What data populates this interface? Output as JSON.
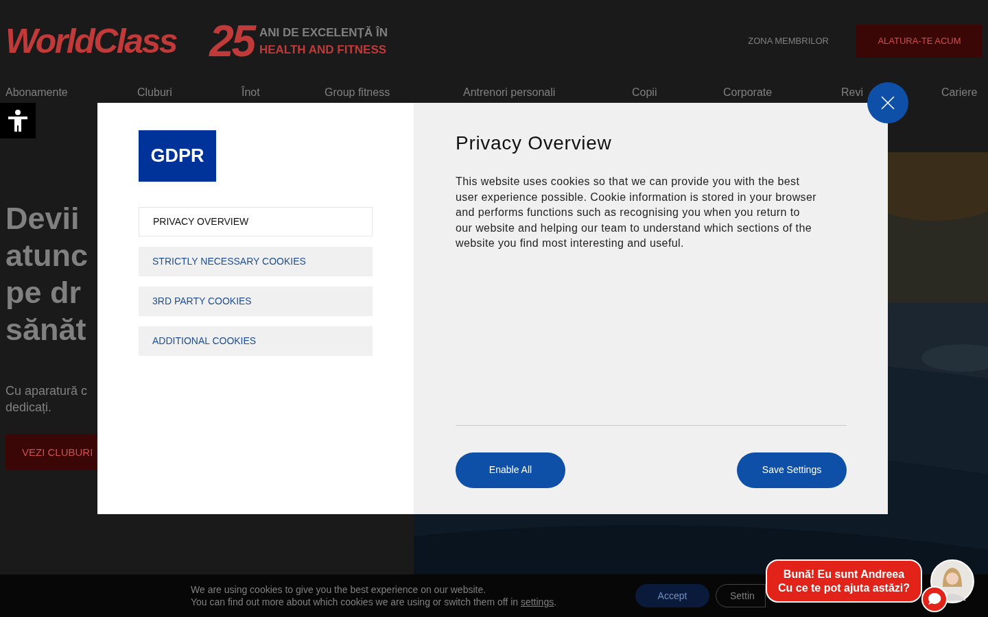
{
  "header": {
    "logo": "WorldClass",
    "anniversary_number": "25",
    "anniversary_line_1": "ANI DE EXCELENȚĂ ÎN",
    "anniversary_line_2": "HEALTH AND FITNESS",
    "members_link": "ZONA MEMBRILOR",
    "join_button": "ALATURA-TE ACUM"
  },
  "nav": [
    "Abonamente",
    "Cluburi",
    "Înot",
    "Group fitness",
    "Antrenori personali",
    "Copii",
    "Corporate",
    "Revi",
    "Cariere"
  ],
  "hero": {
    "heading_lines": [
      "Devii",
      "atunc",
      "pe dr",
      "sănăt"
    ],
    "subtitle_lines": [
      "Cu aparatură c",
      "dedicați."
    ],
    "button": "VEZI CLUBURI"
  },
  "modal": {
    "badge": "GDPR",
    "tabs": [
      {
        "label": "PRIVACY OVERVIEW",
        "selected": true
      },
      {
        "label": "STRICTLY NECESSARY COOKIES",
        "selected": false
      },
      {
        "label": "3RD PARTY COOKIES",
        "selected": false
      },
      {
        "label": "ADDITIONAL COOKIES",
        "selected": false
      }
    ],
    "title": "Privacy Overview",
    "body": "This website uses cookies so that we can provide you with the best user experience possible. Cookie information is stored in your browser and performs functions such as recognising you when you return to our website and helping our team to understand which sections of the website you find most interesting and useful.",
    "enable_all": "Enable All",
    "save_settings": "Save Settings"
  },
  "cookie_bar": {
    "line_1": "We are using cookies to give you the best experience on our website.",
    "line_2": "You can find out more about which cookies we are using or switch them off in ",
    "link": "settings",
    "line_2_end": ".",
    "accept": "Accept",
    "settings": "Settin"
  },
  "chat": {
    "line_1": "Bună! Eu sunt Andreea",
    "line_2": "Cu ce te pot ajuta astăzi?"
  }
}
